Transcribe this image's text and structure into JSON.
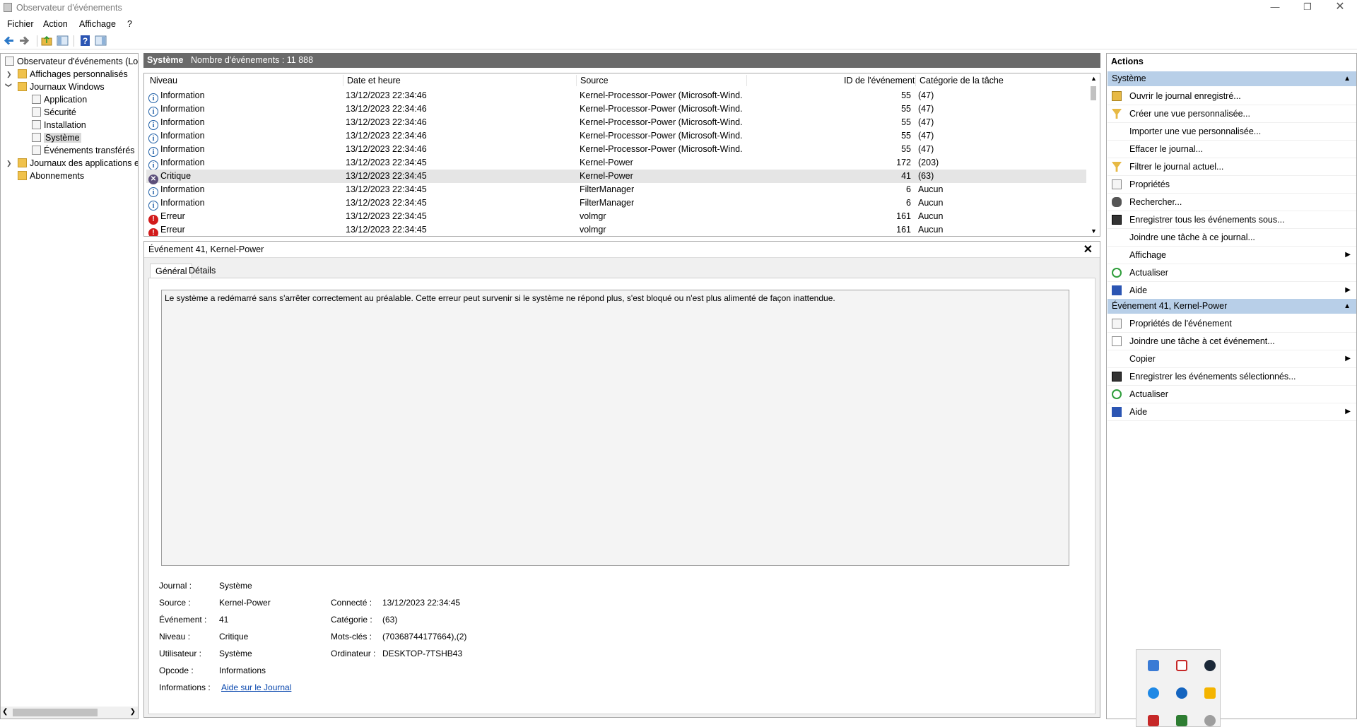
{
  "window": {
    "title": "Observateur d'événements"
  },
  "menu": [
    "Fichier",
    "Action",
    "Affichage",
    "?"
  ],
  "tree": {
    "root": "Observateur d'événements (Local)",
    "custom_views": "Affichages personnalisés",
    "windows_logs": "Journaux Windows",
    "application": "Application",
    "security": "Sécurité",
    "setup": "Installation",
    "system": "Système",
    "forwarded": "Événements transférés",
    "apps_services": "Journaux des applications et",
    "subscriptions": "Abonnements"
  },
  "center": {
    "log_name": "Système",
    "event_count": "Nombre d'événements : 11 888"
  },
  "grid": {
    "columns": [
      "Niveau",
      "Date et heure",
      "Source",
      "ID de l'événement",
      "Catégorie de la tâche"
    ],
    "rows": [
      {
        "level": "Information",
        "icon": "info",
        "date": "13/12/2023 22:34:46",
        "source": "Kernel-Processor-Power (Microsoft-Wind...",
        "id": "55",
        "category": "(47)"
      },
      {
        "level": "Information",
        "icon": "info",
        "date": "13/12/2023 22:34:46",
        "source": "Kernel-Processor-Power (Microsoft-Wind...",
        "id": "55",
        "category": "(47)"
      },
      {
        "level": "Information",
        "icon": "info",
        "date": "13/12/2023 22:34:46",
        "source": "Kernel-Processor-Power (Microsoft-Wind...",
        "id": "55",
        "category": "(47)"
      },
      {
        "level": "Information",
        "icon": "info",
        "date": "13/12/2023 22:34:46",
        "source": "Kernel-Processor-Power (Microsoft-Wind...",
        "id": "55",
        "category": "(47)"
      },
      {
        "level": "Information",
        "icon": "info",
        "date": "13/12/2023 22:34:46",
        "source": "Kernel-Processor-Power (Microsoft-Wind...",
        "id": "55",
        "category": "(47)"
      },
      {
        "level": "Information",
        "icon": "info",
        "date": "13/12/2023 22:34:45",
        "source": "Kernel-Power",
        "id": "172",
        "category": "(203)"
      },
      {
        "level": "Critique",
        "icon": "critical",
        "date": "13/12/2023 22:34:45",
        "source": "Kernel-Power",
        "id": "41",
        "category": "(63)",
        "selected": true
      },
      {
        "level": "Information",
        "icon": "info",
        "date": "13/12/2023 22:34:45",
        "source": "FilterManager",
        "id": "6",
        "category": "Aucun"
      },
      {
        "level": "Information",
        "icon": "info",
        "date": "13/12/2023 22:34:45",
        "source": "FilterManager",
        "id": "6",
        "category": "Aucun"
      },
      {
        "level": "Erreur",
        "icon": "error",
        "date": "13/12/2023 22:34:45",
        "source": "volmgr",
        "id": "161",
        "category": "Aucun"
      },
      {
        "level": "Erreur",
        "icon": "error",
        "date": "13/12/2023 22:34:45",
        "source": "volmgr",
        "id": "161",
        "category": "Aucun"
      }
    ]
  },
  "detail": {
    "title": "Événement 41, Kernel-Power",
    "tabs": [
      "Général",
      "Détails"
    ],
    "description": "Le système a redémarré sans s'arrêter correctement au préalable. Cette erreur peut survenir si le système ne répond plus, s'est bloqué ou n'est plus alimenté de façon inattendue.",
    "labels": {
      "journal": "Journal :",
      "source": "Source :",
      "event": "Événement :",
      "level": "Niveau :",
      "user": "Utilisateur :",
      "opcode": "Opcode :",
      "info": "Informations :",
      "logged": "Connecté :",
      "category": "Catégorie :",
      "keywords": "Mots-clés :",
      "computer": "Ordinateur :"
    },
    "values": {
      "journal": "Système",
      "source": "Kernel-Power",
      "event": "41",
      "level": "Critique",
      "user": "Système",
      "opcode": "Informations",
      "info_link": "Aide sur le Journal",
      "logged": "13/12/2023 22:34:45",
      "category": "(63)",
      "keywords": "(70368744177664),(2)",
      "computer": "DESKTOP-7TSHB43"
    }
  },
  "actions": {
    "title": "Actions",
    "section1": "Système",
    "items1": [
      "Ouvrir le journal enregistré...",
      "Créer une vue personnalisée...",
      "Importer une vue personnalisée...",
      "Effacer le journal...",
      "Filtrer le journal actuel...",
      "Propriétés",
      "Rechercher...",
      "Enregistrer tous les événements sous...",
      "Joindre une tâche à ce journal...",
      "Affichage",
      "Actualiser",
      "Aide"
    ],
    "section2": "Événement 41, Kernel-Power",
    "items2": [
      "Propriétés de l'événement",
      "Joindre une tâche à cet événement...",
      "Copier",
      "Enregistrer les événements sélectionnés...",
      "Actualiser",
      "Aide"
    ]
  },
  "colors": {
    "header_gray": "#6a6a6a",
    "actions_section": "#b8cfe8",
    "info_blue": "#1f5fa6",
    "error_red": "#d21b1b",
    "critical_purple": "#5b4e7a",
    "link": "#0645ad"
  }
}
